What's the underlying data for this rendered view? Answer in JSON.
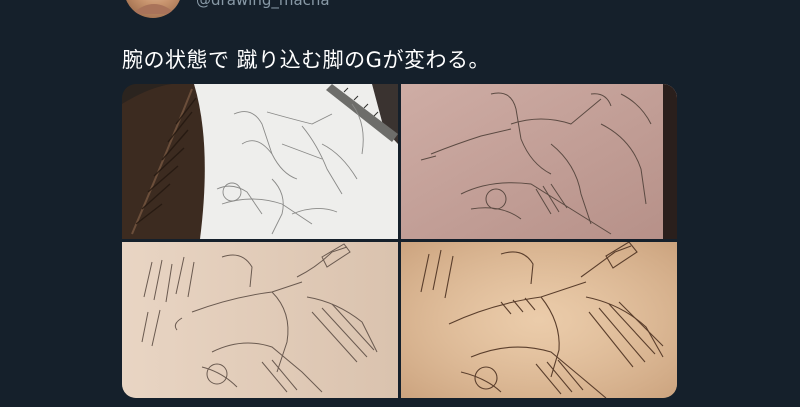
{
  "tweet": {
    "handle": "@drawing_macha",
    "text": "腕の状態で 蹴り込む脚のGが変わる。"
  },
  "media": {
    "count": 4,
    "colors": {
      "background": "#15202b",
      "paper_white": "#eeeeec",
      "paper_pink": "#c9a59d",
      "paper_cream": "#e7d2c0",
      "paper_warm": "#e8c7a4",
      "pencil": "#5b4a42"
    }
  }
}
